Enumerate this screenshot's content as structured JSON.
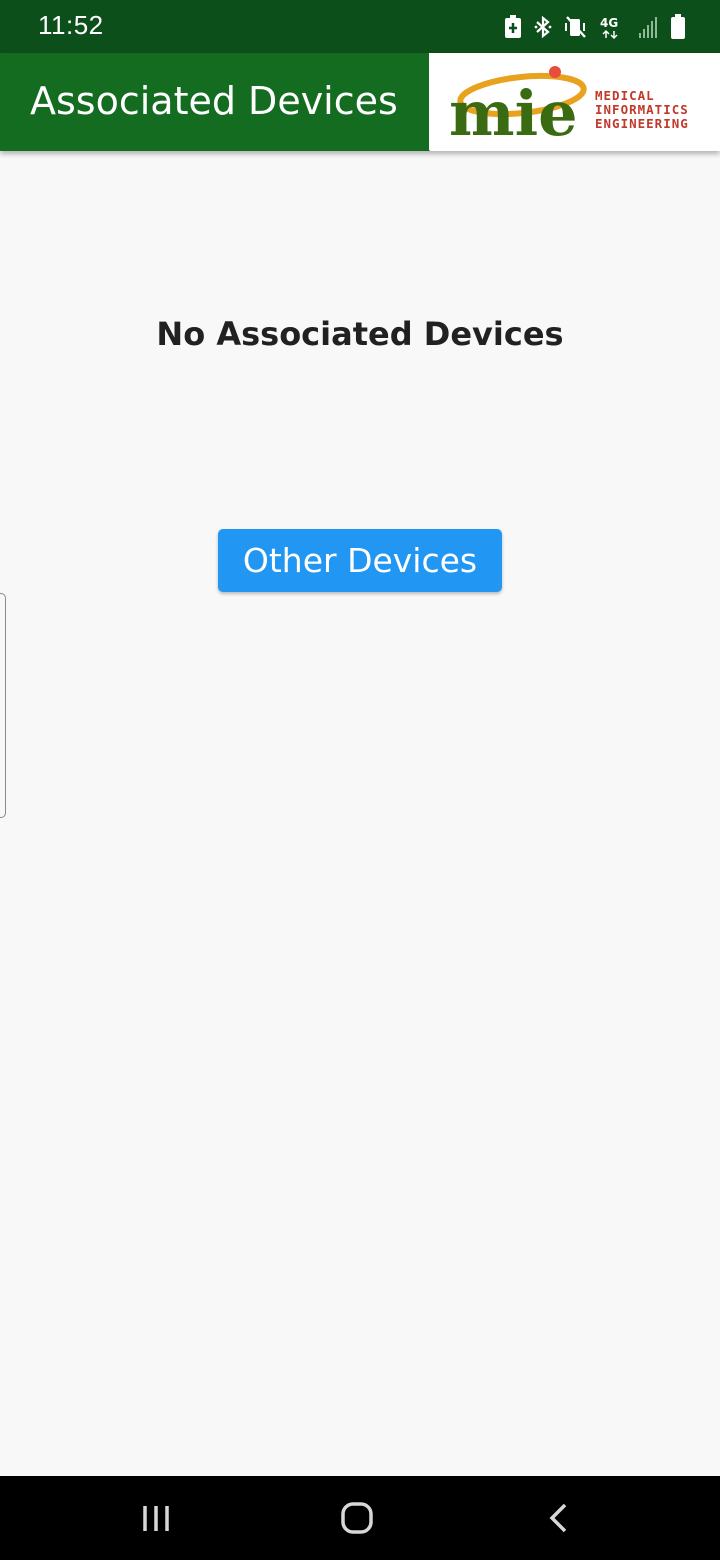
{
  "status_bar": {
    "time": "11:52",
    "icons": [
      "battery-saver-icon",
      "bluetooth-icon",
      "vibrate-mute-icon",
      "4g-lte-icon",
      "signal-icon",
      "battery-icon"
    ],
    "network_label": "4G"
  },
  "app_bar": {
    "title": "Associated Devices",
    "logo": {
      "mark": "mie",
      "line1": "MEDICAL",
      "line2": "INFORMATICS",
      "line3": "ENGINEERING"
    }
  },
  "main": {
    "empty_message": "No Associated Devices",
    "other_devices_label": "Other Devices"
  },
  "nav_bar": {
    "icons": [
      "recents-icon",
      "home-icon",
      "back-icon"
    ]
  },
  "colors": {
    "status_bar": "#0d4f1a",
    "app_bar": "#146c21",
    "button": "#2196f3",
    "background": "#f8f8f8"
  }
}
